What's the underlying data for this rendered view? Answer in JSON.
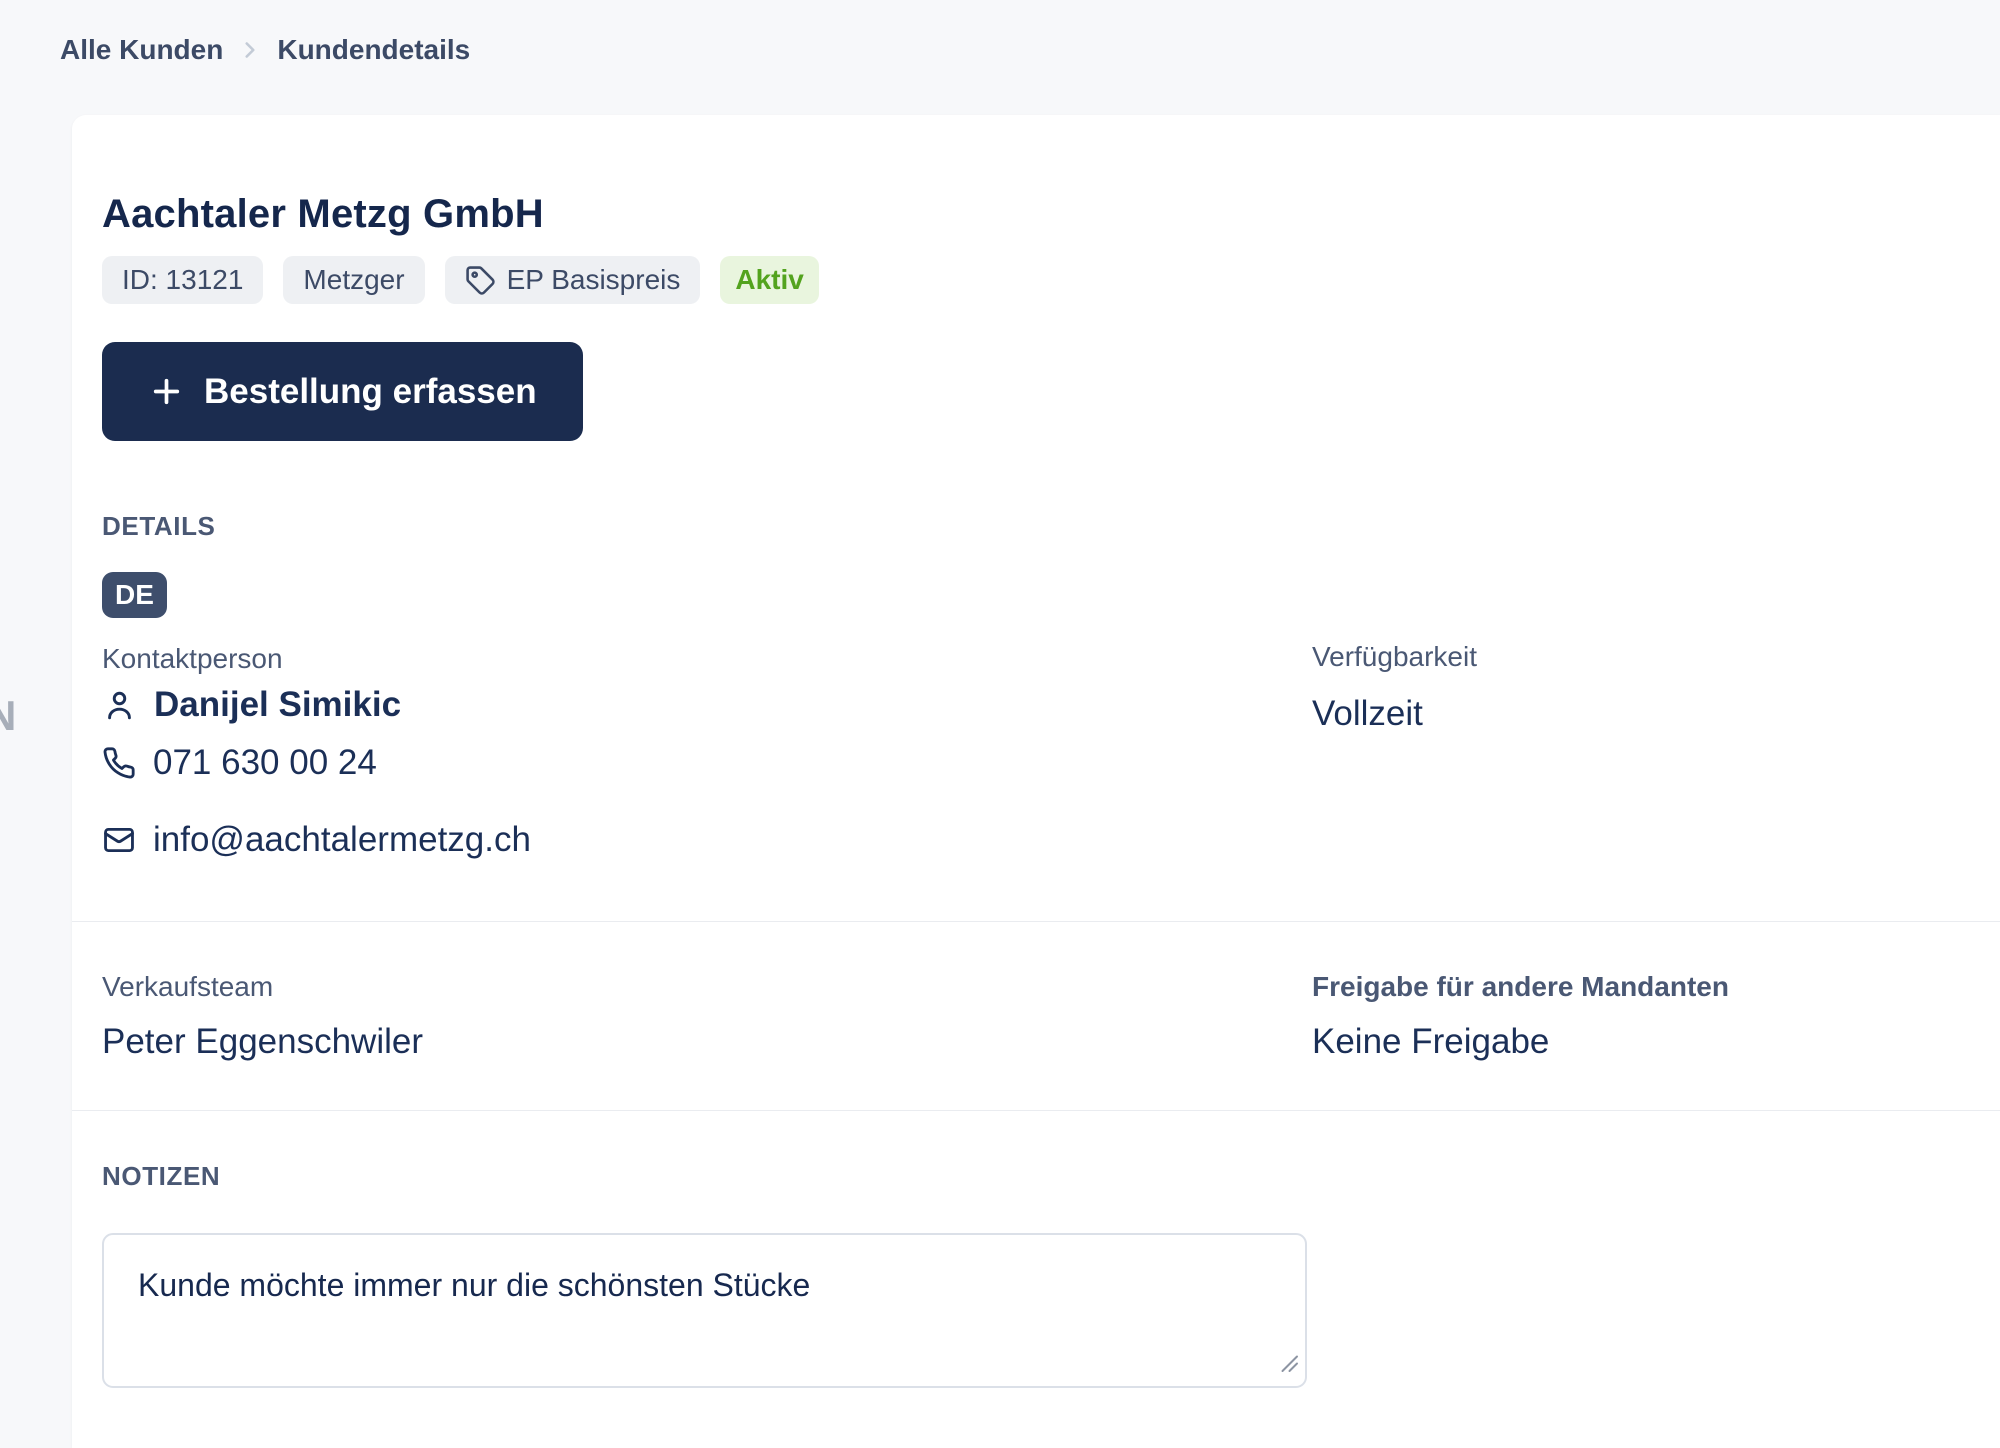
{
  "breadcrumb": {
    "items": [
      {
        "label": "Alle Kunden"
      },
      {
        "label": "Kundendetails"
      }
    ]
  },
  "header": {
    "title": "Aachtaler Metzg GmbH",
    "badges": {
      "id": "ID: 13121",
      "category": "Metzger",
      "price_list": "EP Basispreis",
      "status": "Aktiv"
    },
    "order_button_label": "Bestellung erfassen"
  },
  "details": {
    "heading": "DETAILS",
    "language_badge": "DE",
    "contact": {
      "label": "Kontaktperson",
      "name": "Danijel Simikic",
      "phone": "071 630 00 24",
      "email": "info@aachtalermetzg.ch"
    },
    "availability": {
      "label": "Verfügbarkeit",
      "value": "Vollzeit"
    },
    "sales_team": {
      "label": "Verkaufsteam",
      "value": "Peter Eggenschwiler"
    },
    "tenant_sharing": {
      "label": "Freigabe für andere Mandanten",
      "value": "Keine Freigabe"
    },
    "notes": {
      "heading": "NOTIZEN",
      "value": "Kunde möchte immer nur die schönsten Stücke"
    }
  },
  "sidebar": {
    "clipped_label_fragment": "N"
  },
  "icons": {
    "breadcrumb_separator": "chevron-right-icon",
    "price_list_badge": "tag-icon",
    "order_button": "plus-icon",
    "contact_person": "user-icon",
    "contact_phone": "phone-icon",
    "contact_email": "mail-icon",
    "notes_corner": "resize-grip-icon"
  },
  "colors": {
    "page_background": "#f7f8fa",
    "card_background": "#ffffff",
    "primary_navy": "#1b2c4f",
    "title_navy": "#15274c",
    "value_navy": "#1b2f57",
    "label_slate": "#4a5874",
    "pill_background": "#eef0f3",
    "status_active_bg": "#e9f5de",
    "status_active_text": "#53a31e",
    "language_badge_bg": "#3e4e6c",
    "divider": "#eaecf0"
  }
}
